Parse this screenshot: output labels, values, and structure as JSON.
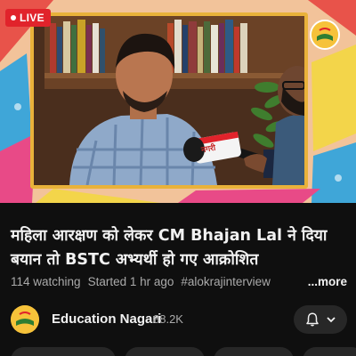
{
  "player": {
    "live_label": "LIVE",
    "mic_brand": "नगरी"
  },
  "video": {
    "title": "महिला आरक्षण को लेकर CM Bhajan Lal ने दिया बयान तो BSTC अभ्यर्थी हो गए आक्रोशित",
    "watching": "114 watching",
    "started": "Started 1 hr ago",
    "hashtag": "#alokrajinterview",
    "more_label": "...more"
  },
  "channel": {
    "name": "Education Nagari",
    "subscribers": "88.2K",
    "logo_text": "नगरी"
  },
  "icons": {
    "live": "live-dot-icon",
    "bell": "bell-icon",
    "chevron": "chevron-down-icon"
  },
  "colors": {
    "live_red": "#e1232b",
    "brand_yellow": "#f6c23a",
    "background": "#0f0f0f"
  }
}
